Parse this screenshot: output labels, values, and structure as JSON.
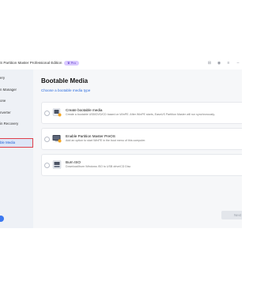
{
  "titlebar": {
    "app_title": "S Partition Master Professional Edition",
    "pro_badge": "Pro"
  },
  "sidebar": {
    "items": [
      {
        "label": "ery",
        "active": false
      },
      {
        "label": "n Manager",
        "active": false
      },
      {
        "label": "one",
        "active": false
      },
      {
        "label": "nverter",
        "active": false
      },
      {
        "label": "in Recovery",
        "active": false
      },
      {
        "label": "ble Media",
        "active": true
      }
    ]
  },
  "main": {
    "title": "Bootable Media",
    "subtitle": "Choose a bootable media type",
    "options": [
      {
        "title": "Create bootable media",
        "description": "Create a bootable USB/DVD/CD based on WinPE. After WinPE starts, EaseUS Partition Master will run synchronously.",
        "icon": "usb-drive-icon"
      },
      {
        "title": "Enable Partition Master PreOS",
        "description": "Add an option to start WinPE in the boot menu of this computer.",
        "icon": "computer-boot-icon"
      },
      {
        "title": "Burn ISO",
        "description": "Download/burn Windows ISO to USB drive/CD Disc",
        "icon": "iso-disc-icon"
      }
    ],
    "next_label": "Next"
  },
  "colors": {
    "accent": "#2f6fe0",
    "active_outline": "#e0404a",
    "badge_bg": "#d9c9ff"
  }
}
